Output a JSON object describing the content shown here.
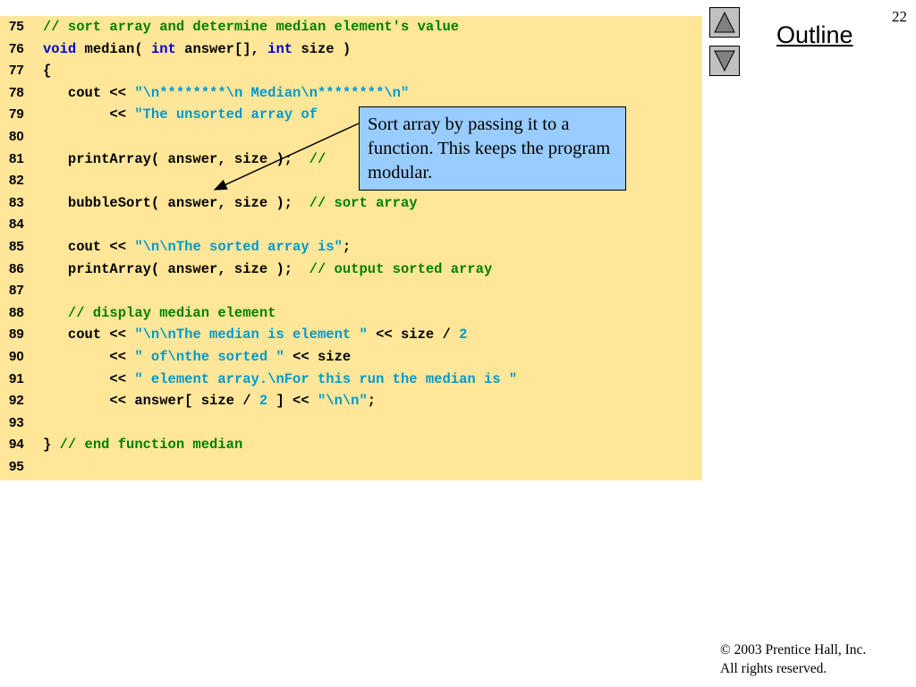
{
  "slide": {
    "number": "22",
    "outline_label": "Outline",
    "callout_text": "Sort array by passing it to a function. This keeps the program modular.",
    "copyright_line": "© 2003 Prentice Hall, Inc.",
    "rights_line": "All rights reserved."
  },
  "nav": {
    "up_icon": "up-triangle-icon",
    "down_icon": "down-triangle-icon"
  },
  "colors": {
    "code_background": "#ffe699",
    "callout_background": "#99ccff",
    "comment": "#008000",
    "keyword": "#0000cc",
    "string": "#0099cc"
  },
  "code_lines": [
    {
      "ln": "75",
      "tokens": [
        {
          "t": "// sort array and determine median element's value",
          "c": "comment"
        }
      ]
    },
    {
      "ln": "76",
      "tokens": [
        {
          "t": "void",
          "c": "keyword"
        },
        {
          "t": " median( ",
          "c": "plain"
        },
        {
          "t": "int",
          "c": "keyword"
        },
        {
          "t": " answer[], ",
          "c": "plain"
        },
        {
          "t": "int",
          "c": "keyword"
        },
        {
          "t": " size )",
          "c": "plain"
        }
      ]
    },
    {
      "ln": "77",
      "tokens": [
        {
          "t": "{",
          "c": "plain"
        }
      ]
    },
    {
      "ln": "78",
      "tokens": [
        {
          "t": "   cout << ",
          "c": "plain"
        },
        {
          "t": "\"\\n********\\n Median\\n********\\n\"",
          "c": "string"
        }
      ]
    },
    {
      "ln": "79",
      "tokens": [
        {
          "t": "        << ",
          "c": "plain"
        },
        {
          "t": "\"The unsorted array of",
          "c": "string"
        }
      ]
    },
    {
      "ln": "80",
      "tokens": []
    },
    {
      "ln": "81",
      "tokens": [
        {
          "t": "   printArray( answer, size );  ",
          "c": "plain"
        },
        {
          "t": "//",
          "c": "comment"
        }
      ]
    },
    {
      "ln": "82",
      "tokens": []
    },
    {
      "ln": "83",
      "tokens": [
        {
          "t": "   bubbleSort( answer, size );  ",
          "c": "plain"
        },
        {
          "t": "// sort array",
          "c": "comment"
        }
      ]
    },
    {
      "ln": "84",
      "tokens": []
    },
    {
      "ln": "85",
      "tokens": [
        {
          "t": "   cout << ",
          "c": "plain"
        },
        {
          "t": "\"\\n\\nThe sorted array is\"",
          "c": "string"
        },
        {
          "t": ";",
          "c": "plain"
        }
      ]
    },
    {
      "ln": "86",
      "tokens": [
        {
          "t": "   printArray( answer, size );  ",
          "c": "plain"
        },
        {
          "t": "// output sorted array",
          "c": "comment"
        }
      ]
    },
    {
      "ln": "87",
      "tokens": []
    },
    {
      "ln": "88",
      "tokens": [
        {
          "t": "   // display median element",
          "c": "comment"
        }
      ]
    },
    {
      "ln": "89",
      "tokens": [
        {
          "t": "   cout << ",
          "c": "plain"
        },
        {
          "t": "\"\\n\\nThe median is element \"",
          "c": "string"
        },
        {
          "t": " << size / ",
          "c": "plain"
        },
        {
          "t": "2",
          "c": "number"
        }
      ]
    },
    {
      "ln": "90",
      "tokens": [
        {
          "t": "        << ",
          "c": "plain"
        },
        {
          "t": "\" of\\nthe sorted \"",
          "c": "string"
        },
        {
          "t": " << size",
          "c": "plain"
        }
      ]
    },
    {
      "ln": "91",
      "tokens": [
        {
          "t": "        << ",
          "c": "plain"
        },
        {
          "t": "\" element array.\\nFor this run the median is \"",
          "c": "string"
        }
      ]
    },
    {
      "ln": "92",
      "tokens": [
        {
          "t": "        << answer[ size / ",
          "c": "plain"
        },
        {
          "t": "2",
          "c": "number"
        },
        {
          "t": " ] << ",
          "c": "plain"
        },
        {
          "t": "\"\\n\\n\"",
          "c": "string"
        },
        {
          "t": ";",
          "c": "plain"
        }
      ]
    },
    {
      "ln": "93",
      "tokens": []
    },
    {
      "ln": "94",
      "tokens": [
        {
          "t": "} ",
          "c": "plain"
        },
        {
          "t": "// end function median",
          "c": "comment"
        }
      ]
    },
    {
      "ln": "95",
      "tokens": []
    }
  ]
}
